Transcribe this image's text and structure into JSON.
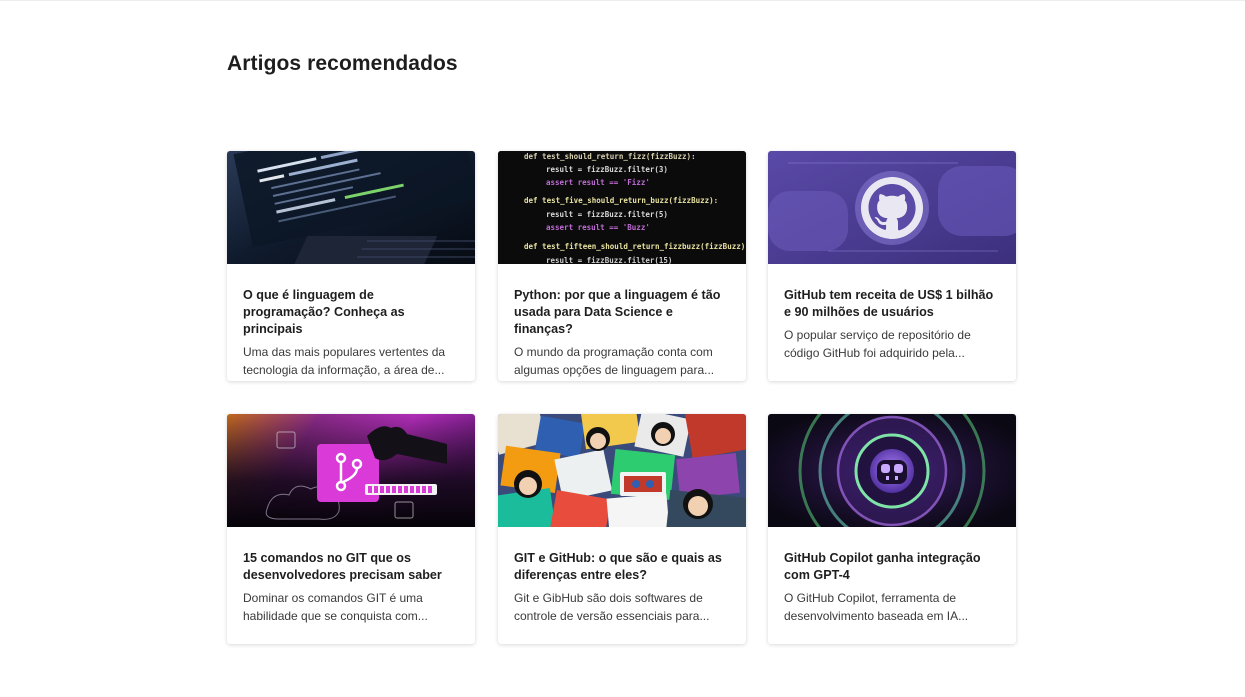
{
  "section": {
    "title": "Artigos recomendados"
  },
  "articles": [
    {
      "title": "O que é linguagem de programação? Conheça as principais",
      "excerpt": "Uma das mais populares vertentes da tecnologia da informação, a área de...",
      "image": "laptop-code-image"
    },
    {
      "title": "Python: por que a linguagem é tão usada para Data Science e finanças?",
      "excerpt": "O mundo da programação conta com algumas opções de linguagem para...",
      "image": "python-code-image",
      "code_lines": [
        "def test_should_return_fizz(fizzBuzz):",
        "result = fizzBuzz.filter(3)",
        "assert result == 'Fizz'",
        "def test_five_should_return_buzz(fizzBuzz):",
        "result = fizzBuzz.filter(5)",
        "assert result == 'Buzz'",
        "def test_fifteen_should_return_fizzbuzz(fizzBuzz):",
        "result = fizzBuzz.filter(15)"
      ]
    },
    {
      "title": "GitHub tem receita de US$ 1 bilhão e 90 milhões de usuários",
      "excerpt": "O popular serviço de repositório de código GitHub foi adquirido pela...",
      "image": "github-logo-image"
    },
    {
      "title": "15 comandos no GIT que os desenvolvedores precisam saber",
      "excerpt": "Dominar os comandos GIT é uma habilidade que se conquista com...",
      "image": "git-branch-illustration"
    },
    {
      "title": "GIT e GitHub: o que são e quais as diferenças entre eles?",
      "excerpt": "Git e GibHub são dois softwares de controle de versão essenciais para...",
      "image": "octocat-stickers-image"
    },
    {
      "title": "GitHub Copilot ganha integração com GPT-4",
      "excerpt": "O GitHub Copilot, ferramenta de desenvolvimento baseada em IA...",
      "image": "copilot-logo-image"
    }
  ],
  "colors": {
    "github_purple": "#6a55b8",
    "copilot_green": "#5ad17a",
    "git_magenta": "#d03bd1"
  }
}
